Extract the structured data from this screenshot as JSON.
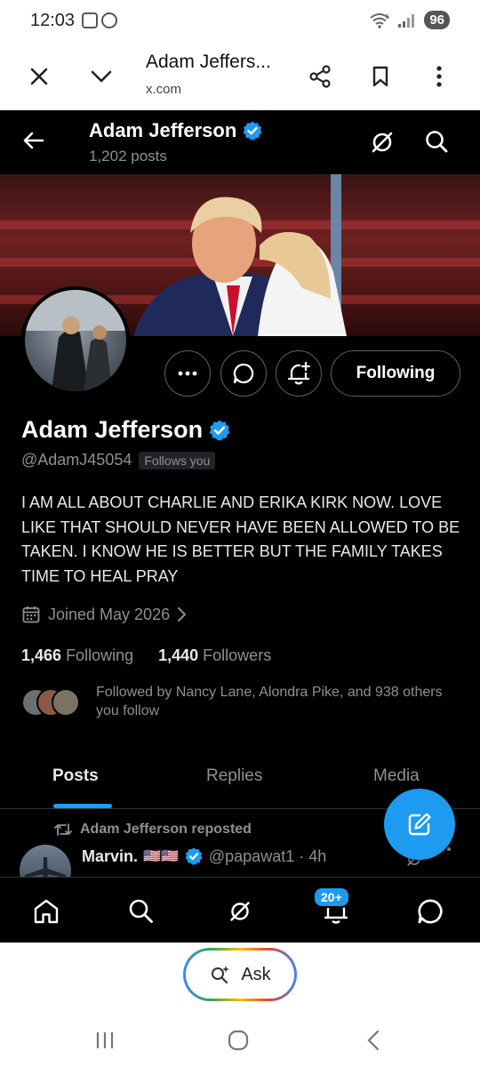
{
  "status_bar": {
    "time": "12:03",
    "battery": "96",
    "wifi_label": "5"
  },
  "browser": {
    "title": "Adam Jeffers...",
    "domain": "x.com"
  },
  "header": {
    "name": "Adam Jefferson",
    "posts": "1,202 posts"
  },
  "actions": {
    "following_label": "Following"
  },
  "profile": {
    "name": "Adam Jefferson",
    "handle": "@AdamJ45054",
    "follows_you": "Follows you",
    "bio": "I AM ALL ABOUT CHARLIE AND ERIKA KIRK NOW. LOVE LIKE THAT SHOULD NEVER HAVE BEEN ALLOWED TO BE TAKEN. I KNOW HE IS BETTER BUT THE FAMILY TAKES TIME TO HEAL PRAY",
    "joined": "Joined May 2026",
    "following_count": "1,466",
    "following_label": "Following",
    "followers_count": "1,440",
    "followers_label": "Followers",
    "followed_by": "Followed by Nancy Lane, Alondra Pike, and 938 others you follow"
  },
  "tabs": {
    "posts": "Posts",
    "replies": "Replies",
    "media": "Media"
  },
  "post": {
    "repost_label": "Adam Jefferson reposted",
    "author": "Marvin.",
    "flags": "🇺🇸🇺🇸",
    "handle_time": "@papawat1 · 4h"
  },
  "bottom_nav": {
    "notification_badge": "20+"
  },
  "ask": {
    "label": "Ask"
  },
  "colors": {
    "accent": "#1d9bf0",
    "background": "#000000",
    "muted": "#8b9096"
  },
  "icons": {
    "browser": [
      "close-icon",
      "chevron-down-icon",
      "share-icon",
      "bookmark-icon",
      "more-vertical-icon"
    ],
    "header": [
      "back-arrow-icon",
      "verified-badge-icon",
      "grok-icon",
      "search-icon"
    ],
    "actions": [
      "more-icon",
      "message-icon",
      "notify-bell-plus-icon"
    ],
    "nav": [
      "home-icon",
      "search-icon",
      "grok-icon",
      "bell-icon",
      "messages-icon"
    ]
  }
}
